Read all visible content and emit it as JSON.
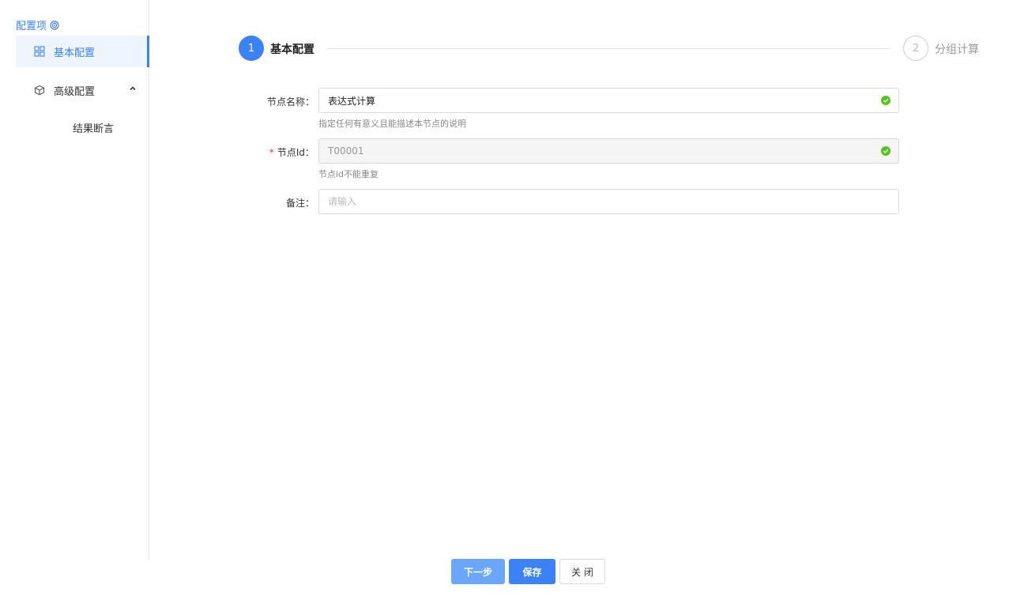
{
  "sidebar": {
    "header": "配置项",
    "items": [
      {
        "label": "基本配置",
        "active": true
      },
      {
        "label": "高级配置",
        "expanded": true,
        "children": [
          {
            "label": "结果断言"
          }
        ]
      }
    ]
  },
  "steps": [
    {
      "index": "1",
      "title": "基本配置",
      "status": "active"
    },
    {
      "index": "2",
      "title": "分组计算",
      "status": "pending"
    }
  ],
  "form": {
    "name": {
      "label": "节点名称：",
      "value": "表达式计算",
      "hint": "指定任何有意义且能描述本节点的说明",
      "valid": true
    },
    "id": {
      "label": "节点Id：",
      "required_mark": "*",
      "value": "T00001",
      "hint": "节点id不能重复",
      "valid": true,
      "disabled": true
    },
    "remark": {
      "label": "备注：",
      "value": "",
      "placeholder": "请输入"
    }
  },
  "buttons": {
    "next": "下一步",
    "save": "保存",
    "close": "关 闭"
  },
  "colors": {
    "primary": "#3b82f6",
    "primary_light": "#6aa7fb",
    "success": "#52c41a",
    "required": "#e53935"
  }
}
